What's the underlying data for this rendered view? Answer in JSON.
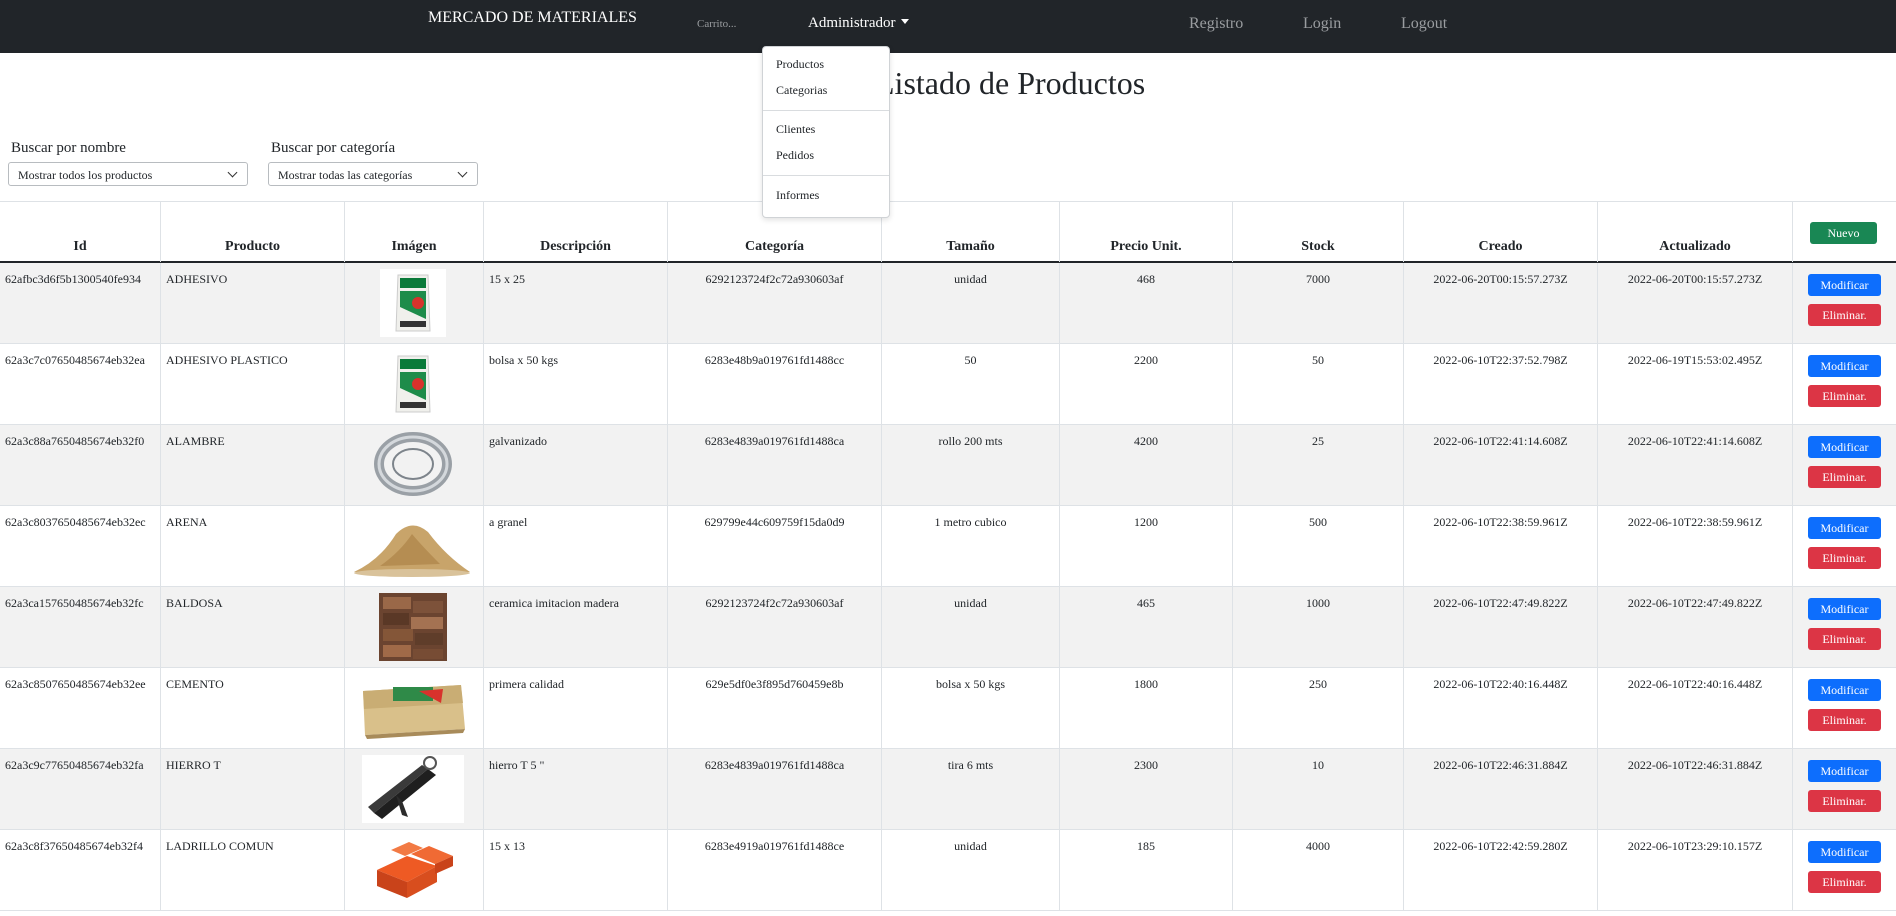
{
  "nav": {
    "brand": "MERCADO DE MATERIALES",
    "cart": "Carrito...",
    "admin": "Administrador",
    "registro": "Registro",
    "login": "Login",
    "logout": "Logout"
  },
  "dropdown": {
    "productos": "Productos",
    "categorias": "Categorias",
    "clientes": "Clientes",
    "pedidos": "Pedidos",
    "informes": "Informes"
  },
  "page_title": "Listado de Productos",
  "filters": {
    "name_label": "Buscar por nombre",
    "name_value": "Mostrar todos los productos",
    "cat_label": "Buscar por categoría",
    "cat_value": "Mostrar todas las categorías"
  },
  "table": {
    "headers": [
      "Id",
      "Producto",
      "Imágen",
      "Descripción",
      "Categoría",
      "Tamaño",
      "Precio Unit.",
      "Stock",
      "Creado",
      "Actualizado"
    ],
    "new_button": "Nuevo",
    "edit_label": "Modificar",
    "delete_label": "Eliminar.",
    "rows": [
      {
        "id": "62afbc3d6f5b1300540fe934",
        "producto": "ADHESIVO",
        "descripcion": "15 x 25",
        "categoria": "6292123724f2c72a930603af",
        "tamano": "unidad",
        "precio": "468",
        "stock": "7000",
        "creado": "2022-06-20T00:15:57.273Z",
        "actualizado": "2022-06-20T00:15:57.273Z",
        "image": "adhesive-bag"
      },
      {
        "id": "62a3c7c07650485674eb32ea",
        "producto": "ADHESIVO PLASTICO",
        "descripcion": "bolsa x 50 kgs",
        "categoria": "6283e48b9a019761fd1488cc",
        "tamano": "50",
        "precio": "2200",
        "stock": "50",
        "creado": "2022-06-10T22:37:52.798Z",
        "actualizado": "2022-06-19T15:53:02.495Z",
        "image": "adhesive-bag"
      },
      {
        "id": "62a3c88a7650485674eb32f0",
        "producto": "ALAMBRE",
        "descripcion": "galvanizado",
        "categoria": "6283e4839a019761fd1488ca",
        "tamano": "rollo 200 mts",
        "precio": "4200",
        "stock": "25",
        "creado": "2022-06-10T22:41:14.608Z",
        "actualizado": "2022-06-10T22:41:14.608Z",
        "image": "wire-coil"
      },
      {
        "id": "62a3c8037650485674eb32ec",
        "producto": "ARENA",
        "descripcion": "a granel",
        "categoria": "629799e44c609759f15da0d9",
        "tamano": "1 metro cubico",
        "precio": "1200",
        "stock": "500",
        "creado": "2022-06-10T22:38:59.961Z",
        "actualizado": "2022-06-10T22:38:59.961Z",
        "image": "sand-pile"
      },
      {
        "id": "62a3ca157650485674eb32fc",
        "producto": "BALDOSA",
        "descripcion": "ceramica imitacion madera",
        "categoria": "6292123724f2c72a930603af",
        "tamano": "unidad",
        "precio": "465",
        "stock": "1000",
        "creado": "2022-06-10T22:47:49.822Z",
        "actualizado": "2022-06-10T22:47:49.822Z",
        "image": "wood-tile"
      },
      {
        "id": "62a3c8507650485674eb32ee",
        "producto": "CEMENTO",
        "descripcion": "primera calidad",
        "categoria": "629e5df0e3f895d760459e8b",
        "tamano": "bolsa x 50 kgs",
        "precio": "1800",
        "stock": "250",
        "creado": "2022-06-10T22:40:16.448Z",
        "actualizado": "2022-06-10T22:40:16.448Z",
        "image": "cement-bag"
      },
      {
        "id": "62a3c9c77650485674eb32fa",
        "producto": "HIERRO T",
        "descripcion": "hierro T 5 \"",
        "categoria": "6283e4839a019761fd1488ca",
        "tamano": "tira 6 mts",
        "precio": "2300",
        "stock": "10",
        "creado": "2022-06-10T22:46:31.884Z",
        "actualizado": "2022-06-10T22:46:31.884Z",
        "image": "t-iron"
      },
      {
        "id": "62a3c8f37650485674eb32f4",
        "producto": "LADRILLO COMUN",
        "descripcion": "15 x 13",
        "categoria": "6283e4919a019761fd1488ce",
        "tamano": "unidad",
        "precio": "185",
        "stock": "4000",
        "creado": "2022-06-10T22:42:59.280Z",
        "actualizado": "2022-06-10T23:29:10.157Z",
        "image": "red-bricks"
      }
    ]
  }
}
